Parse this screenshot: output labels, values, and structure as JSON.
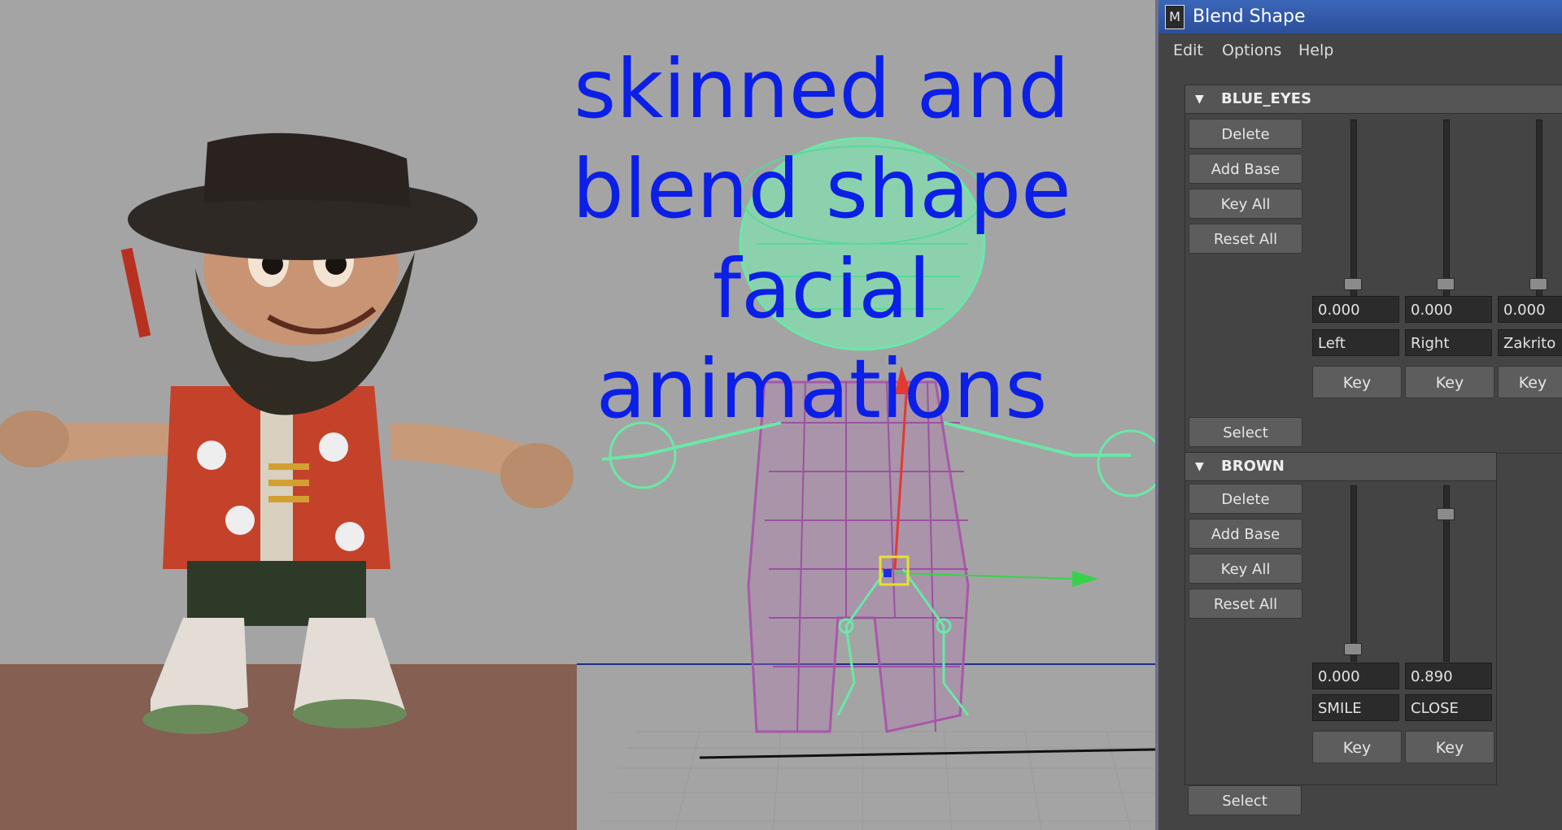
{
  "viewport": {
    "caption": "skinned and\nblend shape\nfacial animations"
  },
  "window": {
    "title": "Blend Shape",
    "icon": "maya-icon"
  },
  "menu": [
    "Edit",
    "Options",
    "Help"
  ],
  "sections": [
    {
      "name": "BLUE_EYES",
      "buttons": [
        "Delete",
        "Add Base",
        "Key All",
        "Reset All"
      ],
      "targets": [
        {
          "value": "0.000",
          "label": "Left",
          "key": "Key",
          "weight": 0.0
        },
        {
          "value": "0.000",
          "label": "Right",
          "key": "Key",
          "weight": 0.0
        },
        {
          "value": "0.000",
          "label": "Zakrito",
          "key": "Key",
          "weight": 0.0
        }
      ],
      "select": "Select"
    },
    {
      "name": "BROWN",
      "buttons": [
        "Delete",
        "Add Base",
        "Key All",
        "Reset All"
      ],
      "targets": [
        {
          "value": "0.000",
          "label": "SMILE",
          "key": "Key",
          "weight": 0.0
        },
        {
          "value": "0.890",
          "label": "CLOSE",
          "key": "Key",
          "weight": 0.89
        }
      ],
      "select": "Select"
    }
  ]
}
